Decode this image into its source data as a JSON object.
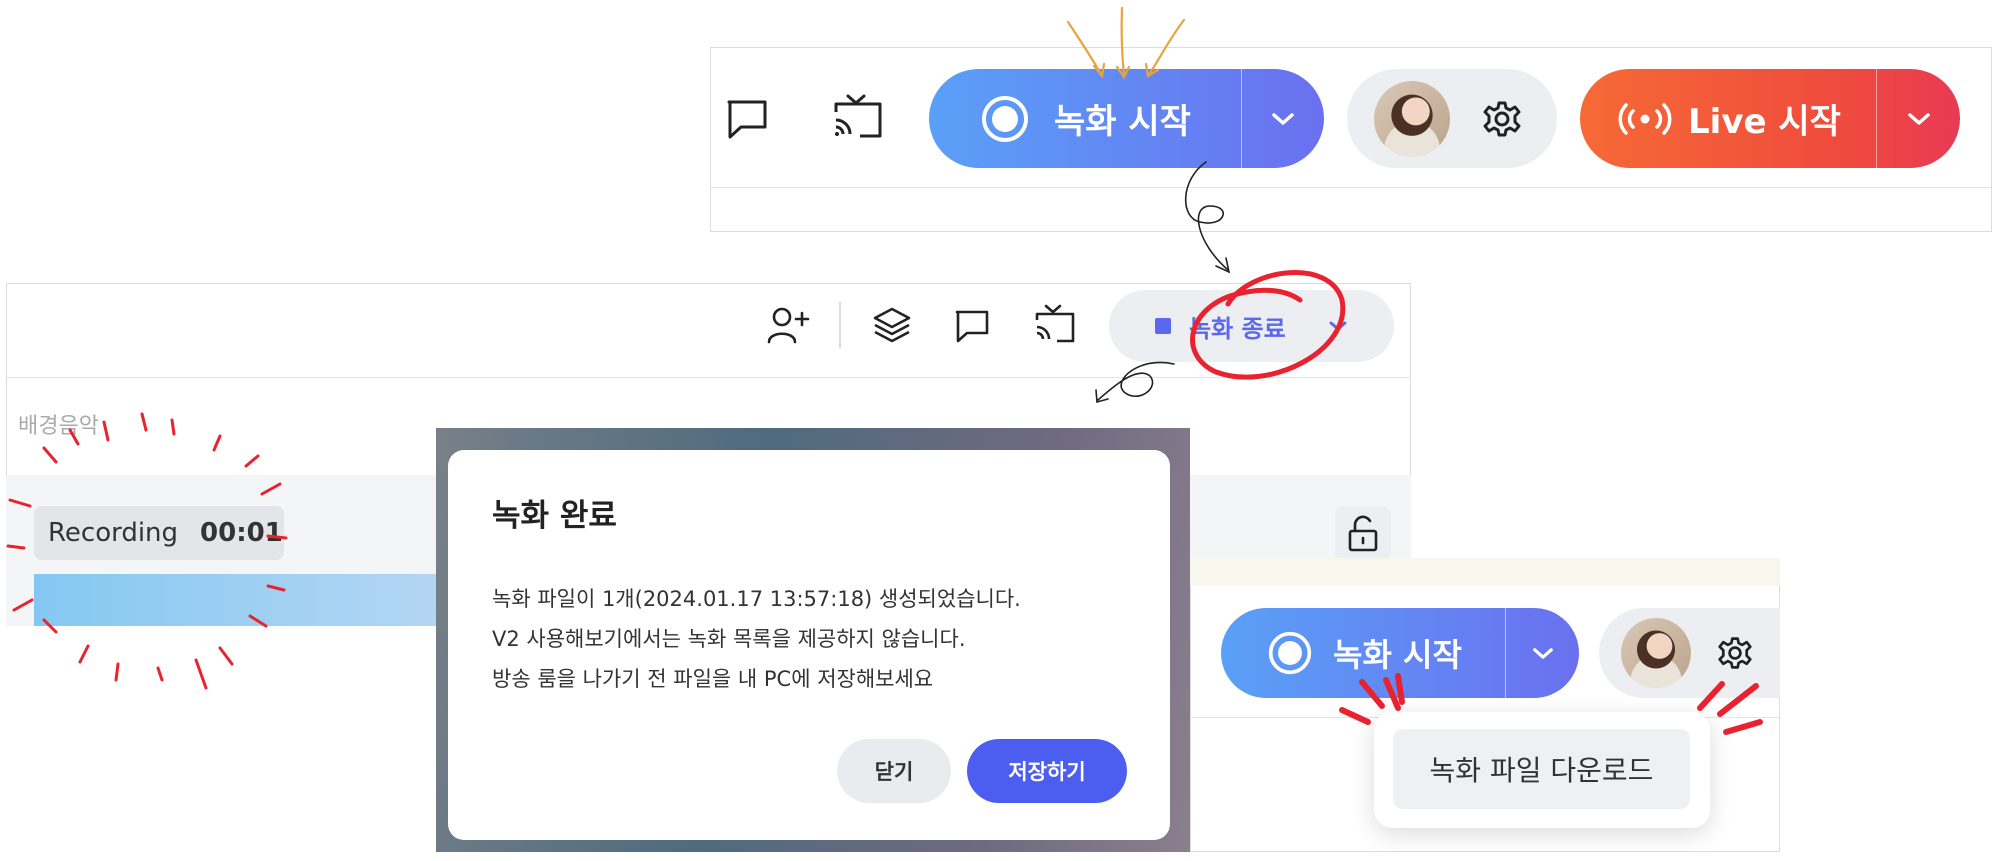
{
  "top_toolbar": {
    "record_label": "녹화 시작",
    "live_label": "Live 시작"
  },
  "mid_toolbar": {
    "stop_label": "녹화 종료",
    "bgm_label": "배경음악"
  },
  "recording_badge": {
    "label": "Recording",
    "time": "00:01"
  },
  "dialog": {
    "title": "녹화 완료",
    "lines": [
      "녹화 파일이 1개(2024.01.17 13:57:18) 생성되었습니다.",
      "V2 사용해보기에서는 녹화 목록을 제공하지 않습니다.",
      "방송 룸을 나가기 전 파일을 내 PC에 저장해보세요"
    ],
    "close_label": "닫기",
    "save_label": "저장하기"
  },
  "bottom_toolbar": {
    "record_label": "녹화 시작",
    "download_label": "녹화 파일 다운로드"
  },
  "colors": {
    "record_gradient_start": "#5aa0f7",
    "record_gradient_end": "#6a70ef",
    "live_gradient_start": "#f66a35",
    "live_gradient_end": "#e83a55",
    "save_button": "#4b5ef0",
    "stop_accent": "#5b67ef",
    "annotation_red": "#e8232f",
    "annotation_orange": "#e8a33a"
  }
}
